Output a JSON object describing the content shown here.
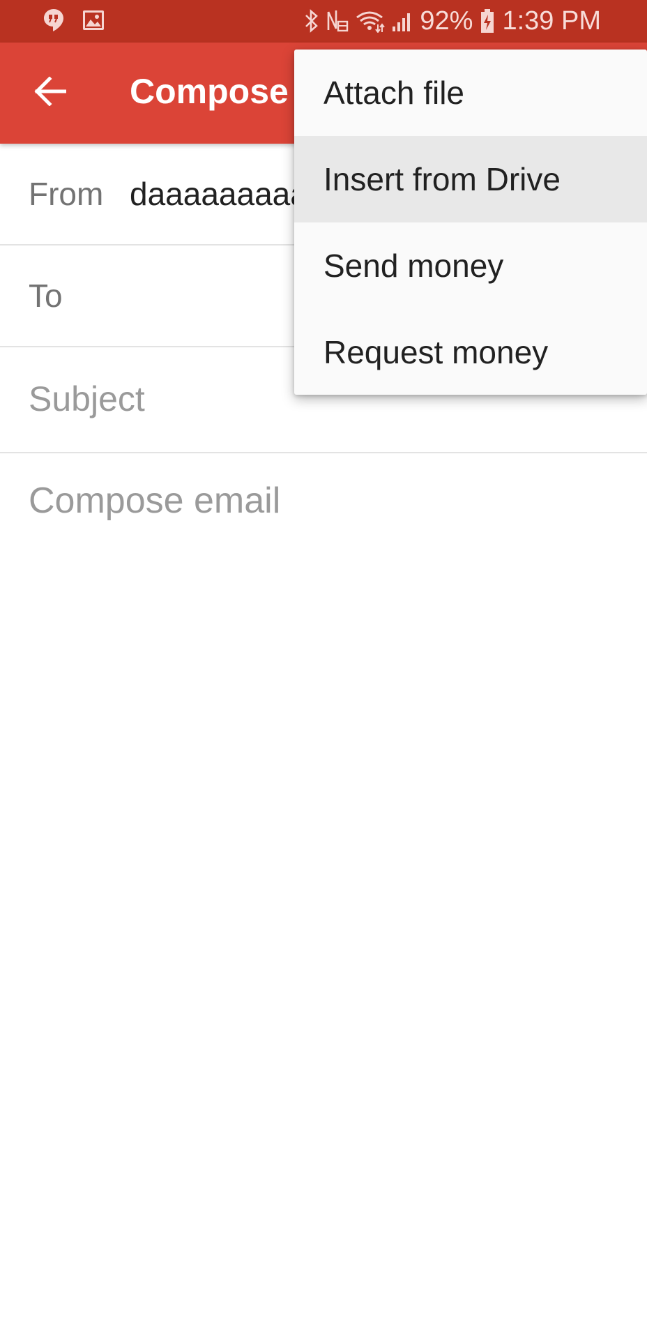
{
  "status_bar": {
    "left_icons": [
      "hangouts-notification-icon",
      "image-notification-icon"
    ],
    "right_icons": [
      "bluetooth-icon",
      "nfc-icon",
      "wifi-icon",
      "signal-icon",
      "battery-charging-icon"
    ],
    "battery": "92%",
    "time": "1:39 PM"
  },
  "app_bar": {
    "title": "Compose",
    "back_icon": "arrow-back-icon",
    "color": "#db4437"
  },
  "form": {
    "from_label": "From",
    "from_value": "daaaaaaaaa",
    "to_label": "To",
    "to_value": "",
    "subject_placeholder": "Subject",
    "body_placeholder": "Compose email"
  },
  "menu": {
    "items": [
      {
        "label": "Attach file"
      },
      {
        "label": "Insert from Drive"
      },
      {
        "label": "Send money"
      },
      {
        "label": "Request money"
      }
    ],
    "highlighted_index": 1
  },
  "colors": {
    "status_bar": "#b93221",
    "accent": "#db4437",
    "menu_background": "#fafafa",
    "menu_highlight": "#e8e8e8"
  }
}
